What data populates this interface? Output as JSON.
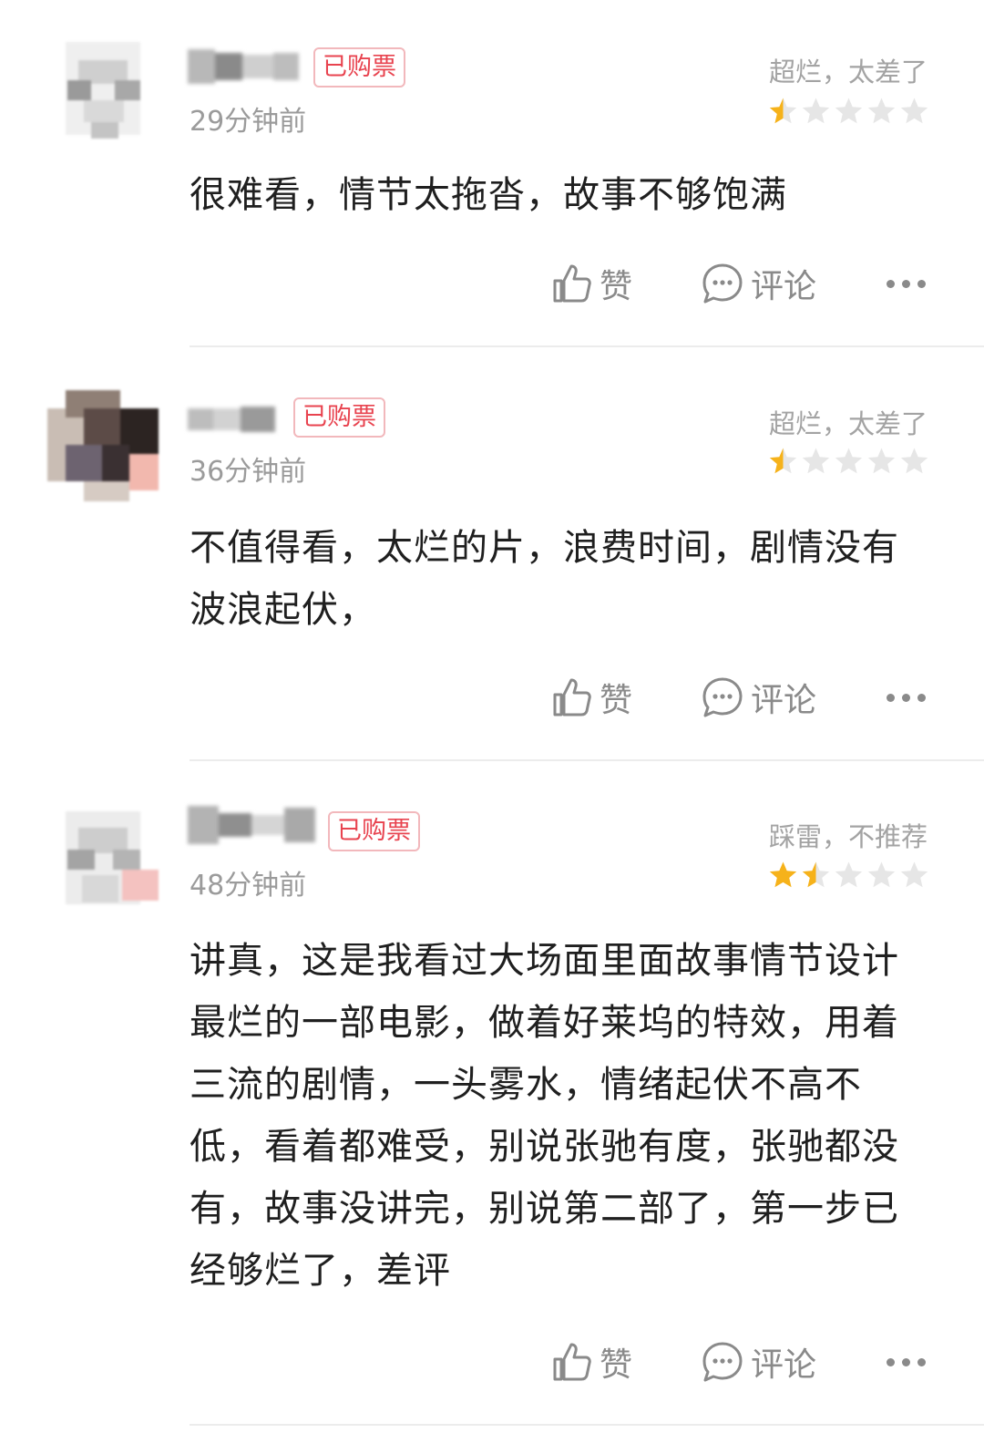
{
  "colors": {
    "badge_text": "#e8434f",
    "badge_border": "#f2b8bc",
    "star_filled": "#f6b21a",
    "star_empty": "#e6e6e6",
    "meta_text": "#9b9b9b"
  },
  "reviews": [
    {
      "badge": "已购票",
      "time": "29分钟前",
      "rating_text": "超烂，太差了",
      "stars": 0.5,
      "content": "很难看，情节太拖沓，故事不够饱满",
      "like_label": "赞",
      "comment_label": "评论",
      "icons": {
        "like": "thumbs-up-icon",
        "comment": "comment-bubble-icon",
        "more": "more-dots-icon"
      }
    },
    {
      "badge": "已购票",
      "time": "36分钟前",
      "rating_text": "超烂，太差了",
      "stars": 0.5,
      "content": "不值得看，太烂的片，浪费时间，剧情没有波浪起伏，",
      "like_label": "赞",
      "comment_label": "评论",
      "icons": {
        "like": "thumbs-up-icon",
        "comment": "comment-bubble-icon",
        "more": "more-dots-icon"
      }
    },
    {
      "badge": "已购票",
      "time": "48分钟前",
      "rating_text": "踩雷，不推荐",
      "stars": 1.5,
      "content": "讲真，这是我看过大场面里面故事情节设计最烂的一部电影，做着好莱坞的特效，用着三流的剧情，一头雾水，情绪起伏不高不低，看着都难受，别说张驰有度，张驰都没有，故事没讲完，别说第二部了，第一步已经够烂了，差评",
      "like_label": "赞",
      "comment_label": "评论",
      "icons": {
        "like": "thumbs-up-icon",
        "comment": "comment-bubble-icon",
        "more": "more-dots-icon"
      }
    }
  ]
}
